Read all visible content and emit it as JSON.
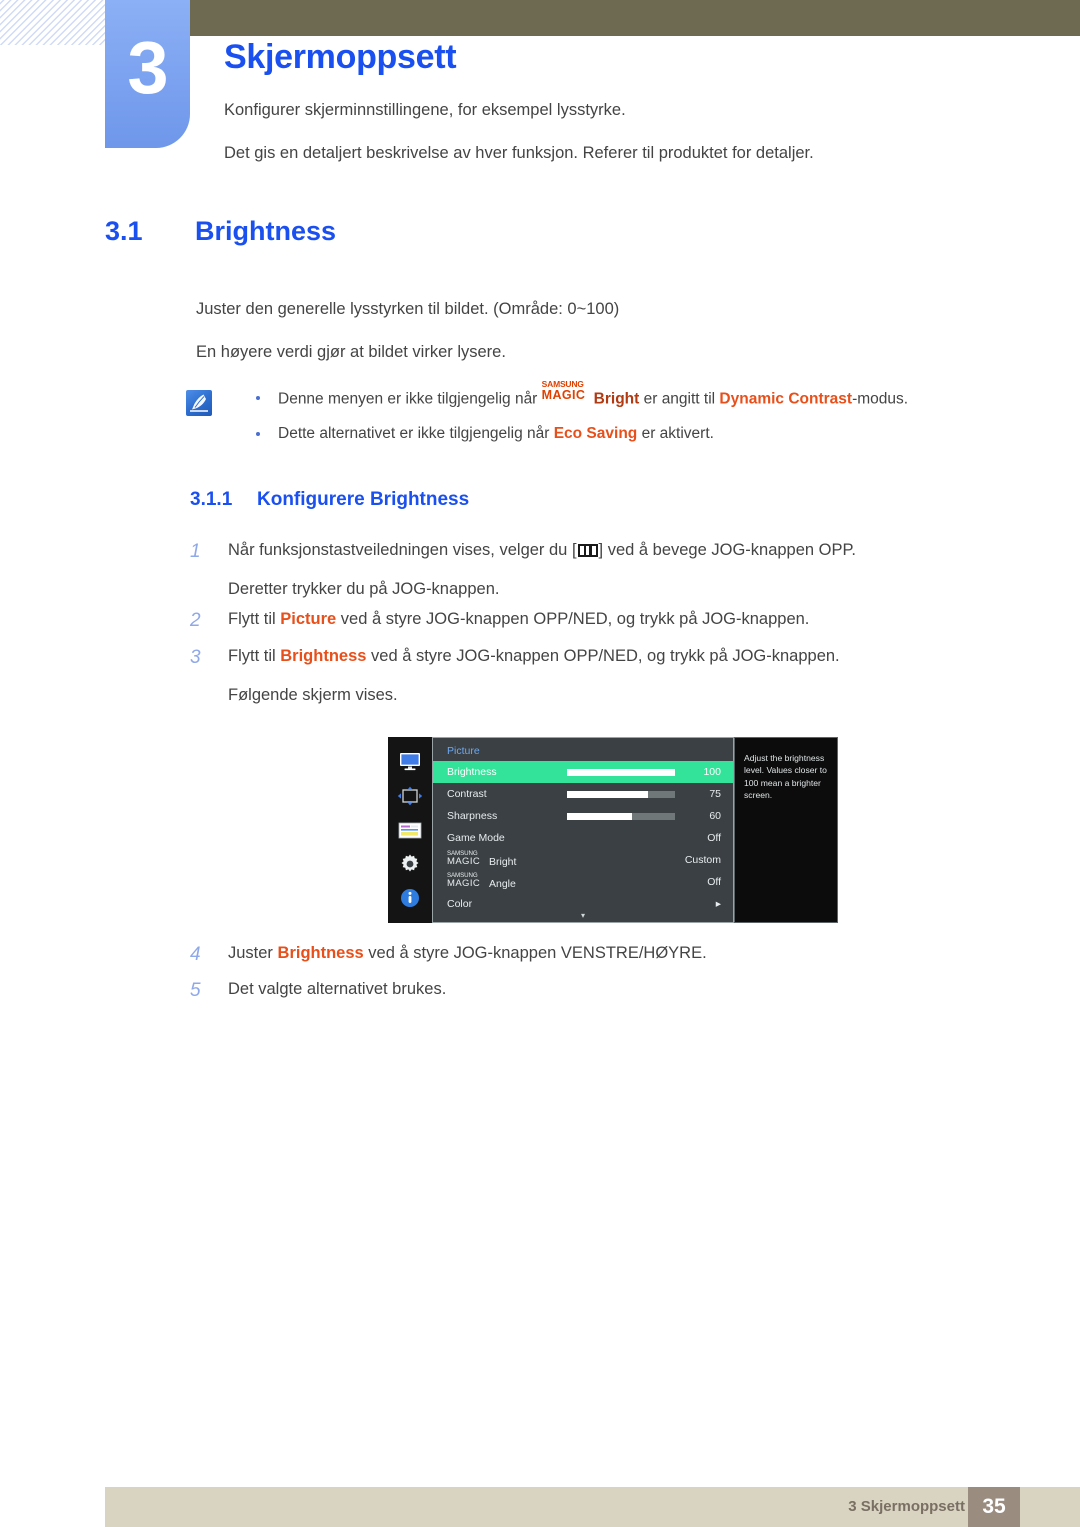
{
  "chapter": {
    "number": "3",
    "title": "Skjermoppsett",
    "intro_line_1": "Konfigurer skjerminnstillingene, for eksempel lysstyrke.",
    "intro_line_2": "Det gis en detaljert beskrivelse av hver funksjon. Referer til produktet for detaljer."
  },
  "section": {
    "number": "3.1",
    "title": "Brightness",
    "paragraph_1": "Juster den generelle lysstyrken til bildet. (Område: 0~100)",
    "paragraph_2": "En høyere verdi gjør at bildet virker lysere."
  },
  "note": {
    "icon": "note-pen-icon",
    "bullet_1": {
      "pre": "Denne menyen er ikke tilgjengelig når ",
      "brand_top": "SAMSUNG",
      "brand_bottom": "MAGIC",
      "brand_word": "Bright",
      "mid": " er angitt til ",
      "accent": "Dynamic Contrast",
      "post": "-modus."
    },
    "bullet_2": {
      "pre": "Dette alternativet er ikke tilgjengelig når ",
      "accent": "Eco Saving",
      "post": " er aktivert."
    }
  },
  "subsection": {
    "number": "3.1.1",
    "title": "Konfigurere Brightness"
  },
  "steps": [
    {
      "index": "1",
      "text_before": "Når funksjonstastveiledningen vises, velger du [",
      "icon": "jog-menu-icon",
      "text_after": "] ved å bevege JOG-knappen OPP.",
      "continuation": "Deretter trykker du på JOG-knappen."
    },
    {
      "index": "2",
      "text_before": "Flytt til ",
      "accent": "Picture",
      "text_after": " ved å styre JOG-knappen OPP/NED, og trykk på JOG-knappen."
    },
    {
      "index": "3",
      "text_before": "Flytt til ",
      "accent": "Brightness",
      "text_after": " ved å styre JOG-knappen OPP/NED, og trykk på JOG-knappen.",
      "continuation": "Følgende skjerm vises."
    },
    {
      "index": "4",
      "text_before": "Juster ",
      "accent": "Brightness",
      "text_after": " ved å styre JOG-knappen VENSTRE/HØYRE."
    },
    {
      "index": "5",
      "text_before": "Det valgte alternativet brukes."
    }
  ],
  "osd": {
    "title": "Picture",
    "rail_icons": [
      "monitor-icon",
      "move-arrows-icon",
      "onscreen-menu-icon",
      "gear-icon",
      "info-icon"
    ],
    "rows": [
      {
        "label": "Brightness",
        "value": "100",
        "slider": 100,
        "highlighted": true
      },
      {
        "label": "Contrast",
        "value": "75",
        "slider": 75,
        "highlighted": false
      },
      {
        "label": "Sharpness",
        "value": "60",
        "slider": 60,
        "highlighted": false
      },
      {
        "label": "Game Mode",
        "value": "Off",
        "slider": null,
        "highlighted": false
      },
      {
        "label": "Bright",
        "value": "Custom",
        "brand_top": "SAMSUNG",
        "brand_bottom": "MAGIC",
        "slider": null,
        "highlighted": false
      },
      {
        "label": "Angle",
        "value": "Off",
        "brand_top": "SAMSUNG",
        "brand_bottom": "MAGIC",
        "slider": null,
        "highlighted": false
      },
      {
        "label": "Color",
        "value": "▸",
        "slider": null,
        "highlighted": false
      }
    ],
    "scroll_caret": "▾",
    "help_text": "Adjust the brightness level. Values closer to 100 mean a brighter screen."
  },
  "footer": {
    "text": "3 Skjermoppsett",
    "page_number": "35"
  },
  "colors": {
    "heading_blue": "#1a4ff0",
    "accent_orange": "#e8501b",
    "header_olive": "#6e6a51",
    "tab_blue": "#7ba2f0",
    "footer_beige": "#d9d4c2",
    "page_box_brown": "#9b8c80",
    "osd_highlight_green": "#33e39a"
  }
}
